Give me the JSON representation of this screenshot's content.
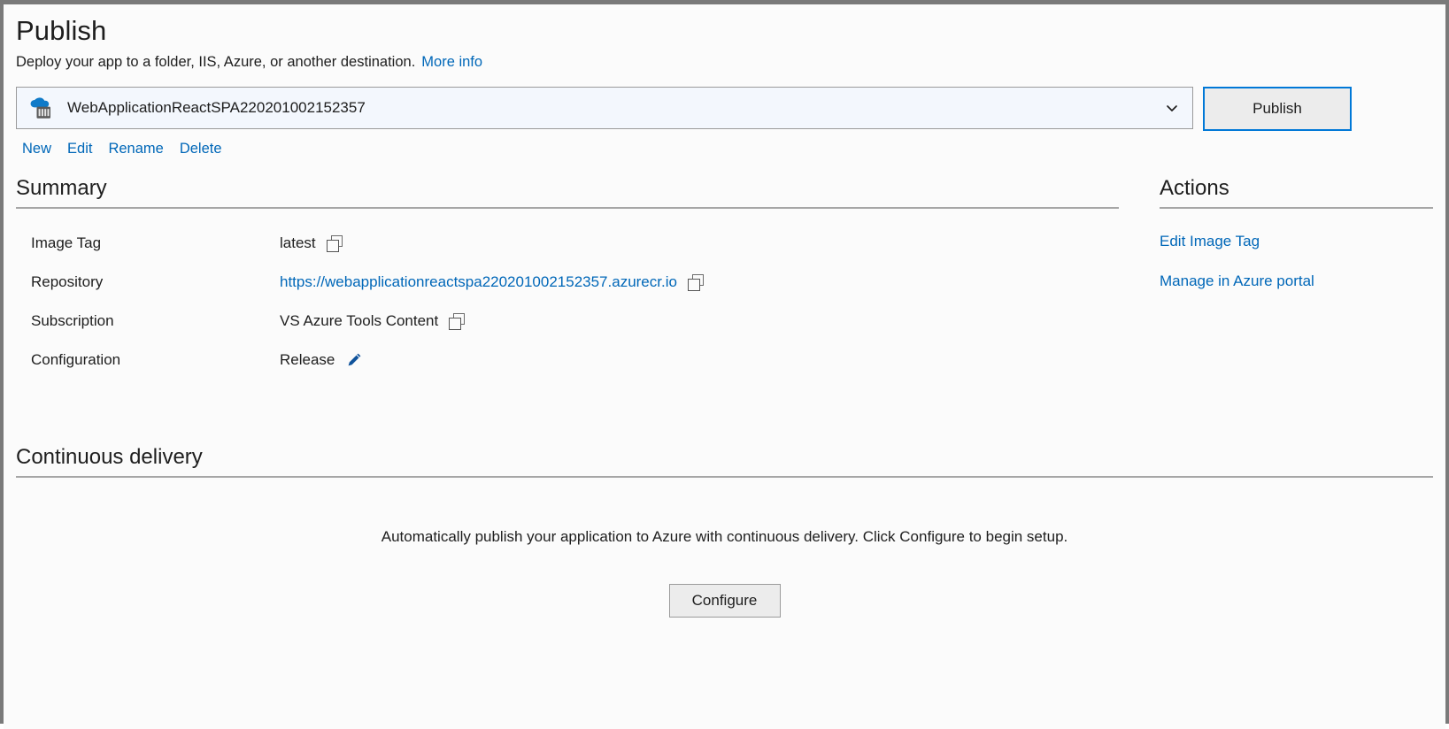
{
  "header": {
    "title": "Publish",
    "subtitle": "Deploy your app to a folder, IIS, Azure, or another destination.",
    "more_info_label": "More info"
  },
  "profile": {
    "selected_name": "WebApplicationReactSPA220201002152357",
    "icon": "azure-container-registry-icon",
    "dropdown_icon": "chevron-down-icon",
    "publish_button_label": "Publish",
    "links": [
      {
        "label": "New"
      },
      {
        "label": "Edit"
      },
      {
        "label": "Rename"
      },
      {
        "label": "Delete"
      }
    ]
  },
  "summary": {
    "heading": "Summary",
    "rows": [
      {
        "label": "Image Tag",
        "value": "latest",
        "is_link": false,
        "trailing_icon": "copy-icon"
      },
      {
        "label": "Repository",
        "value": "https://webapplicationreactspa220201002152357.azurecr.io",
        "is_link": true,
        "trailing_icon": "copy-icon"
      },
      {
        "label": "Subscription",
        "value": "VS Azure Tools Content",
        "is_link": false,
        "trailing_icon": "copy-icon"
      },
      {
        "label": "Configuration",
        "value": "Release",
        "is_link": false,
        "trailing_icon": "pencil-icon"
      }
    ]
  },
  "actions": {
    "heading": "Actions",
    "items": [
      {
        "label": "Edit Image Tag"
      },
      {
        "label": "Manage in Azure portal"
      }
    ]
  },
  "continuous_delivery": {
    "heading": "Continuous delivery",
    "description": "Automatically publish your application to Azure with continuous delivery. Click Configure to begin setup.",
    "configure_button_label": "Configure"
  },
  "colors": {
    "link": "#0067b8",
    "accent_focus": "#0078d7",
    "text": "#1e1e1e",
    "rule": "#a6a6a6",
    "surface": "#fbfbfb",
    "field_fill": "#f3f7fd",
    "button_fill": "#ececec"
  }
}
